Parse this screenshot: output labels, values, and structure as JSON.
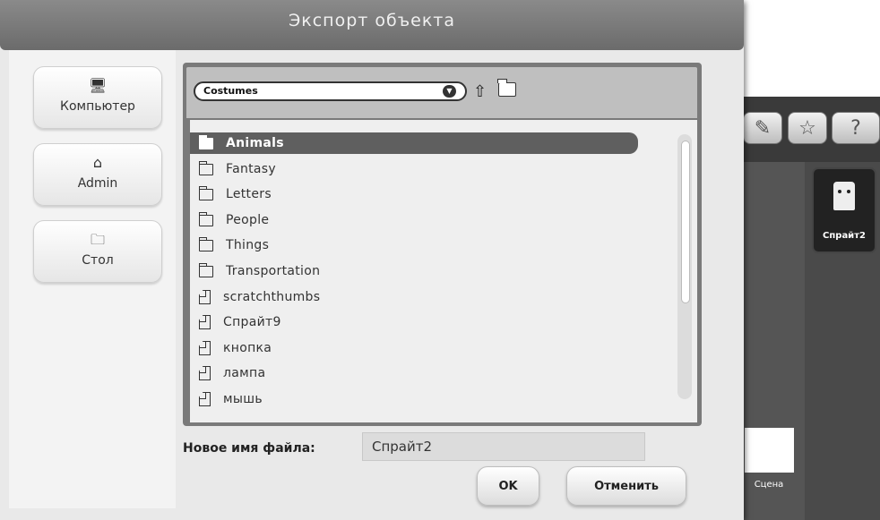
{
  "dialog": {
    "title": "Экспорт объекта",
    "places": [
      {
        "label": "Компьютер",
        "icon": "computer-icon",
        "glyph": "🖥"
      },
      {
        "label": "Admin",
        "icon": "home-icon",
        "glyph": "⌂"
      },
      {
        "label": "Стол",
        "icon": "desktop-folder-icon",
        "glyph": "🗀"
      }
    ],
    "folder_select": "Costumes",
    "items": [
      {
        "name": "Animals",
        "type": "folder",
        "selected": true
      },
      {
        "name": "Fantasy",
        "type": "folder"
      },
      {
        "name": "Letters",
        "type": "folder"
      },
      {
        "name": "People",
        "type": "folder"
      },
      {
        "name": "Things",
        "type": "folder"
      },
      {
        "name": "Transportation",
        "type": "folder"
      },
      {
        "name": "scratchthumbs",
        "type": "file"
      },
      {
        "name": "Спрайт9",
        "type": "file"
      },
      {
        "name": "кнопка",
        "type": "file"
      },
      {
        "name": "лампа",
        "type": "file"
      },
      {
        "name": "мышь",
        "type": "file"
      }
    ],
    "filename_label": "Новое имя файла:",
    "filename_value": "Спрайт2",
    "ok_label": "OK",
    "cancel_label": "Отменить"
  },
  "background": {
    "sprite_label": "Спрайт2",
    "stage_label": "Сцена",
    "toolbar_icons": [
      "paint-sprite-icon",
      "random-sprite-icon",
      "choose-sprite-icon"
    ]
  }
}
